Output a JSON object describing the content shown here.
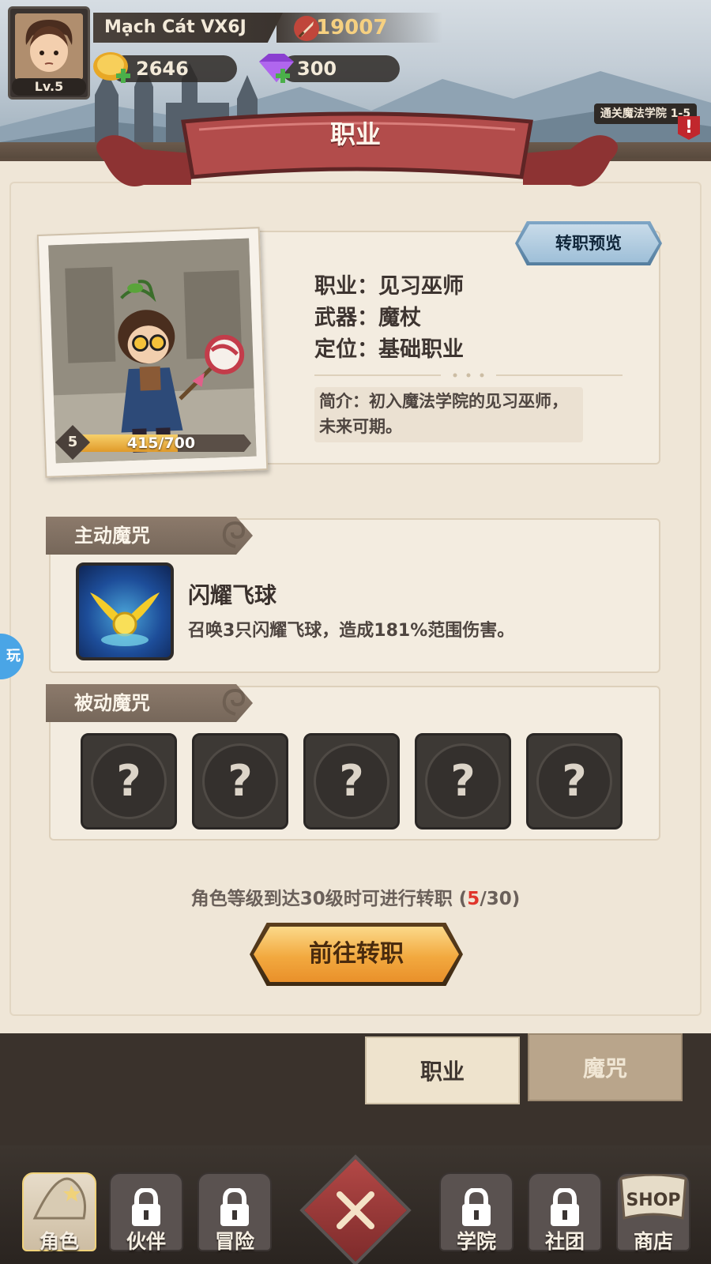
{
  "player": {
    "name": "Mạch Cát VX6J",
    "level": "Lv.5",
    "power": "19007",
    "gold": "2646",
    "gems": "300"
  },
  "quest_tag": "通关魔法学院 1-5",
  "alert": "!",
  "page_title": "职业",
  "preview_button": "转职预览",
  "class_info": {
    "class_line": "职业：见习巫师",
    "weapon_line": "武器：魔杖",
    "role_line": "定位：基础职业",
    "description": "简介：初入魔法学院的见习巫师，未来可期。"
  },
  "portrait": {
    "level": "5",
    "xp_text": "415/700",
    "xp_fraction": 0.593
  },
  "active_spell": {
    "section_title": "主动魔咒",
    "name": "闪耀飞球",
    "description": "召唤3只闪耀飞球，造成181%范围伤害。"
  },
  "passive_spells": {
    "section_title": "被动魔咒",
    "slots": [
      "?",
      "?",
      "?",
      "?",
      "?"
    ]
  },
  "requirement": {
    "text_before": "角色等级到达30级时可进行转职 (",
    "current": "5",
    "text_after": "/30)"
  },
  "goto_button": "前往转职",
  "section_tabs": {
    "active": "职业",
    "inactive": "魔咒"
  },
  "side_float": "玩",
  "nav": {
    "role": "角色",
    "partner": "伙伴",
    "adventure": "冒险",
    "academy": "学院",
    "club": "社团",
    "shop": "商店",
    "shop_sign": "SHOP"
  },
  "colors": {
    "accent_red": "#e0352b",
    "banner_red": "#b34846",
    "gold_button": "#f2a93f",
    "preview_blue": "#9ebfd8"
  }
}
